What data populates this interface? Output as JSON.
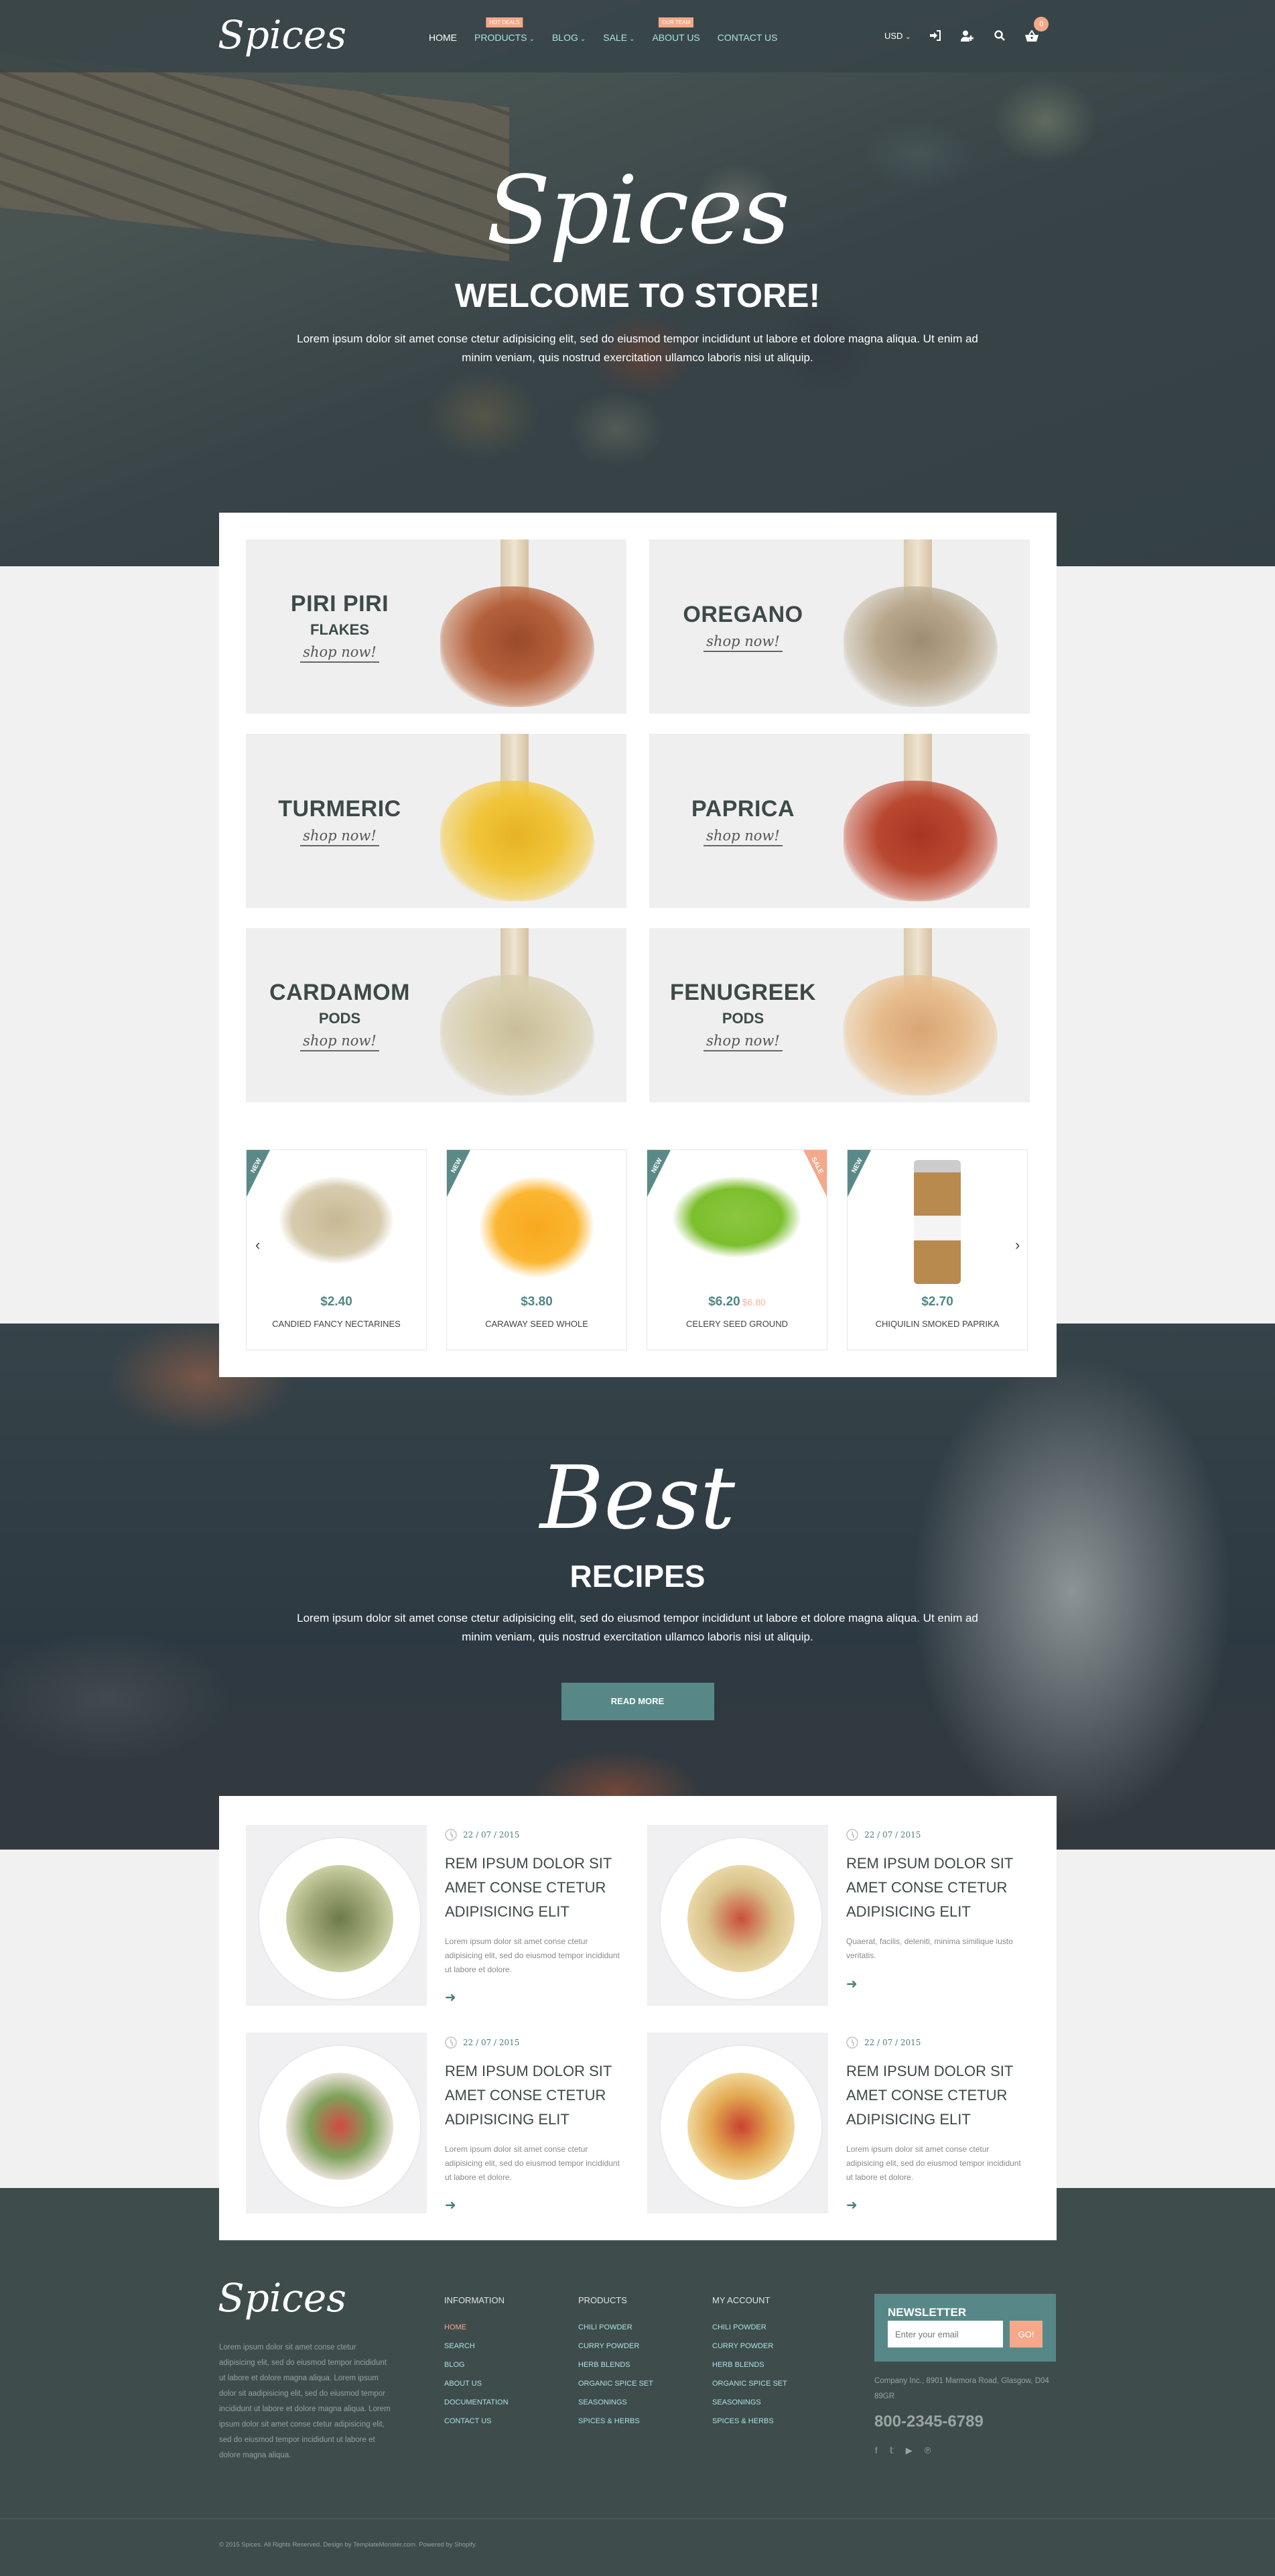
{
  "header": {
    "logo": "Spices",
    "nav": [
      {
        "label": "HOME",
        "badge": null,
        "dropdown": false
      },
      {
        "label": "PRODUCTS",
        "badge": "HOT DEALS",
        "dropdown": true
      },
      {
        "label": "BLOG",
        "badge": null,
        "dropdown": true
      },
      {
        "label": "SALE",
        "badge": null,
        "dropdown": true
      },
      {
        "label": "ABOUT US",
        "badge": "OUR TEAM",
        "dropdown": false
      },
      {
        "label": "CONTACT US",
        "badge": null,
        "dropdown": false
      }
    ],
    "currency": "USD",
    "icons": [
      "login-icon",
      "register-user-icon",
      "search-icon",
      "cart-icon"
    ],
    "cart_count": "0"
  },
  "hero": {
    "script": "Spices",
    "title": "WELCOME TO STORE!",
    "text": "Lorem ipsum dolor sit amet conse ctetur adipisicing elit, sed do eiusmod tempor incididunt ut labore et dolore magna aliqua. Ut enim ad minim veniam, quis nostrud exercitation ullamco laboris nisi ut aliquip."
  },
  "categories": [
    {
      "name": "PIRI PIRI",
      "sub": "FLAKES",
      "cta": "shop now!"
    },
    {
      "name": "OREGANO",
      "sub": "",
      "cta": "shop now!"
    },
    {
      "name": "TURMERIC",
      "sub": "",
      "cta": "shop now!"
    },
    {
      "name": "PAPRICA",
      "sub": "",
      "cta": "shop now!"
    },
    {
      "name": "CARDAMOM",
      "sub": "PODS",
      "cta": "shop now!"
    },
    {
      "name": "FENUGREEK",
      "sub": "PODS",
      "cta": "shop now!"
    }
  ],
  "products": [
    {
      "name": "CANDIED FANCY NECTARINES",
      "price": "$2.40",
      "old_price": "",
      "badge": "NEW",
      "sale": ""
    },
    {
      "name": "CARAWAY SEED WHOLE",
      "price": "$3.80",
      "old_price": "",
      "badge": "NEW",
      "sale": ""
    },
    {
      "name": "CELERY SEED GROUND",
      "price": "$6.20",
      "old_price": "$6.80",
      "badge": "NEW",
      "sale": "SALE"
    },
    {
      "name": "CHIQUILIN SMOKED PAPRIKA",
      "price": "$2.70",
      "old_price": "",
      "badge": "NEW",
      "sale": ""
    }
  ],
  "carousel": {
    "prev": "‹",
    "next": "›"
  },
  "recipes": {
    "script": "Best",
    "title": "RECIPES",
    "text": "Lorem ipsum dolor sit amet conse ctetur adipisicing elit, sed do eiusmod tempor incididunt ut labore et dolore magna aliqua. Ut enim ad minim veniam, quis nostrud exercitation ullamco laboris nisi ut aliquip.",
    "button": "READ MORE"
  },
  "posts": [
    {
      "date": "22 / 07 / 2015",
      "title": "REM IPSUM DOLOR SIT AMET CONSE CTETUR ADIPISICING ELIT",
      "excerpt": "Lorem ipsum dolor sit amet conse ctetur adipisicing elit, sed do eiusmod tempor incididunt ut labore et dolore."
    },
    {
      "date": "22 / 07 / 2015",
      "title": "REM IPSUM DOLOR SIT AMET CONSE CTETUR ADIPISICING ELIT",
      "excerpt": "Quaerat, facilis, deleniti, minima similique iusto veritatis."
    },
    {
      "date": "22 / 07 / 2015",
      "title": "REM IPSUM DOLOR SIT AMET CONSE CTETUR ADIPISICING ELIT",
      "excerpt": "Lorem ipsum dolor sit amet conse ctetur adipisicing elit, sed do eiusmod tempor incididunt ut labore et dolore."
    },
    {
      "date": "22 / 07 / 2015",
      "title": "REM IPSUM DOLOR SIT AMET CONSE CTETUR ADIPISICING ELIT",
      "excerpt": "Lorem ipsum dolor sit amet conse ctetur adipisicing elit, sed do eiusmod tempor incididunt ut labore et dolore."
    }
  ],
  "footer": {
    "logo": "Spices",
    "about": "Lorem ipsum dolor sit amet conse ctetur adipisicing elit, sed do eiusmod tempor incididunt ut labore et dolore magna aliqua. Lorem ipsum dolor sit aadipisicing elit, sed do eiusmod tempor incididunt ut labore et dolore magna aliqua. Lorem ipsum dolor sit amet conse ctetur adipisicing elit, sed do eiusmod tempor incididunt ut labore et dolore magna aliqua.",
    "columns": [
      {
        "title": "INFORMATION",
        "links": [
          "HOME",
          "SEARCH",
          "BLOG",
          "ABOUT US",
          "DOCUMENTATION",
          "CONTACT US"
        ]
      },
      {
        "title": "PRODUCTS",
        "links": [
          "CHILI POWDER",
          "CURRY POWDER",
          "HERB BLENDS",
          "ORGANIC SPICE SET",
          "SEASONINGS",
          "SPICES & HERBS"
        ]
      },
      {
        "title": "MY ACCOUNT",
        "links": [
          "CHILI POWDER",
          "CURRY POWDER",
          "HERB BLENDS",
          "ORGANIC SPICE SET",
          "SEASONINGS",
          "SPICES & HERBS"
        ]
      }
    ],
    "newsletter": {
      "title": "NEWSLETTER",
      "placeholder": "Enter your email",
      "button": "GO!"
    },
    "address": "Company Inc., 8901 Marmora Road, Glasgow, D04 89GR",
    "phone": "800-2345-6789",
    "social": [
      "facebook-icon",
      "twitter-icon",
      "youtube-icon",
      "pinterest-icon"
    ],
    "copyright": "© 2015 Spices. All Rights Reserved. Design by TemplateMonster.com. Powered by Shopify."
  },
  "colors": {
    "accent_teal": "#578887",
    "accent_peach": "#f4a98a",
    "dark": "#3f4c4c",
    "link_teal": "#a9e3e3"
  }
}
